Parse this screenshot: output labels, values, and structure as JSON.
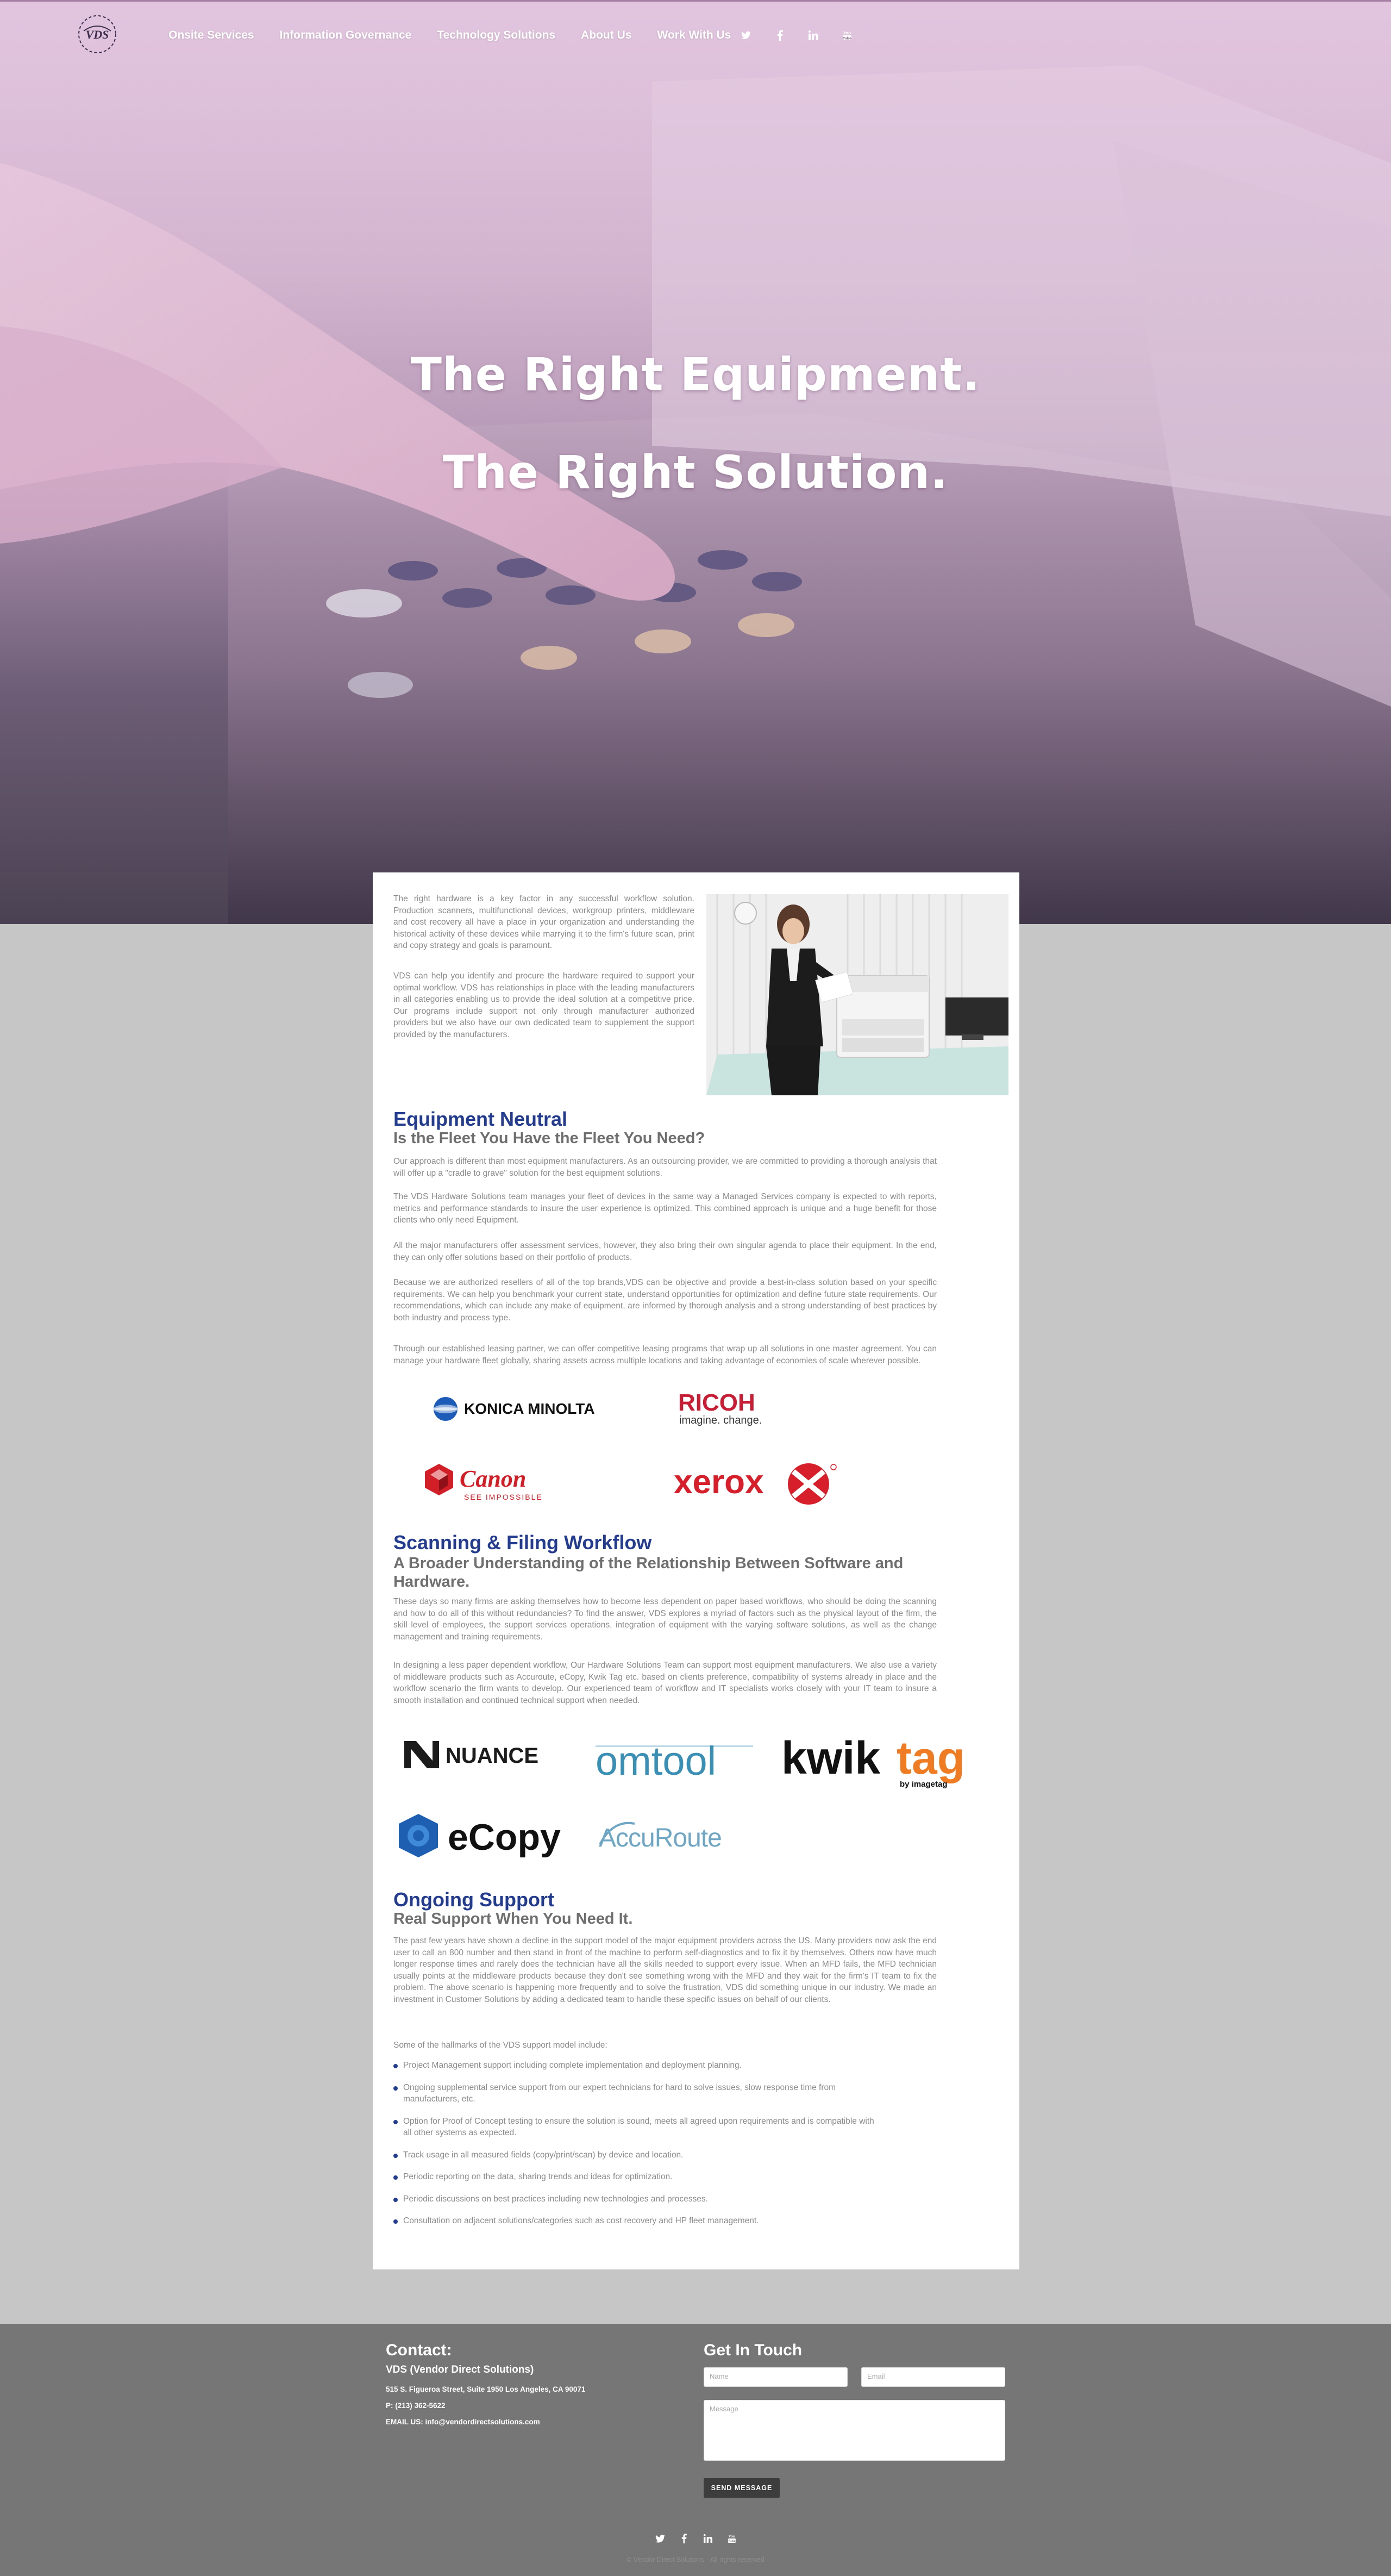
{
  "nav": {
    "logo_text": "VDS",
    "links": [
      "Onsite Services",
      "Information Governance",
      "Technology Solutions",
      "About Us",
      "Work With Us"
    ],
    "social": [
      "twitter-icon",
      "facebook-icon",
      "linkedin-icon",
      "youtube-icon"
    ]
  },
  "hero": {
    "line1": "The Right Equipment.",
    "line2": "The Right Solution."
  },
  "intro": {
    "p1": "The right hardware is a key factor in any successful workflow solution. Production scanners, multifunctional devices, workgroup printers, middleware and cost recovery all have a place in your organization and understanding the historical activity of these devices while marrying it to the firm's future scan, print and copy strategy and goals is paramount.",
    "p2": "VDS can help you identify and procure the hardware required to support your optimal workflow. VDS has relationships in place with the leading manufacturers in all categories enabling us to provide the ideal solution at a competitive price. Our programs include support not only through manufacturer authorized providers but we also have our own dedicated team to supplement the support provided by the manufacturers."
  },
  "equipment": {
    "title": "Equipment Neutral",
    "subtitle": "Is the Fleet You Have the Fleet You Need?",
    "p1": "Our approach is different than most equipment manufacturers. As an outsourcing provider, we are committed to providing a thorough analysis that will offer up a \"cradle to grave\" solution for the best equipment solutions.",
    "p2": "The VDS Hardware Solutions team manages your fleet of devices in the same way a Managed Services company is expected to with reports, metrics and performance standards to insure the user experience is optimized. This combined approach is unique and a huge benefit for those clients who only need Equipment.",
    "p3": "All the major manufacturers offer assessment services, however, they also bring their own singular agenda to place their equipment. In the end, they can only offer solutions based on their portfolio of products.",
    "p4": "Because we are authorized resellers of all of the top brands,VDS can be objective and provide a best-in-class solution based on your specific requirements. We can help you benchmark your current state, understand opportunities for optimization and define future state requirements. Our recommendations, which can include any make of equipment, are informed by thorough analysis and a strong understanding of best practices by both industry and process type.",
    "p5": "Through our established leasing partner, we can offer competitive leasing programs that wrap up all solutions in one master agreement. You can manage your hardware fleet globally, sharing assets across multiple locations and taking advantage of economies of scale wherever possible.",
    "logos": {
      "konica": "KONICA MINOLTA",
      "ricoh": "RICOH",
      "ricoh_tag": "imagine. change.",
      "canon": "Canon",
      "canon_tag": "SEE IMPOSSIBLE",
      "xerox": "xerox"
    }
  },
  "scanning": {
    "title": "Scanning & Filing Workflow",
    "subtitle": "A Broader Understanding of the Relationship Between Software and Hardware.",
    "p1": "These days so many firms are asking themselves how to become less dependent on paper based workflows, who should be doing the scanning and how to do all of this without redundancies? To find the answer, VDS explores a myriad of factors such as the physical layout of the firm, the skill level of employees, the support services operations, integration of equipment with the varying software solutions, as well as the change management and training requirements.",
    "p2": "In designing a less paper dependent workflow, Our Hardware Solutions Team can support most equipment manufacturers. We also use a variety of middleware products such as Accuroute, eCopy, Kwik Tag etc. based on clients preference, compatibility of systems already in place and the workflow scenario the firm wants to develop. Our experienced team of workflow and IT specialists works closely with your IT team to insure a smooth installation and continued technical support when needed.",
    "logos": {
      "nuance": "NUANCE",
      "omtool": "omtool",
      "kwik": "kwik",
      "tag": "tag",
      "kwik_by": "by imagetag",
      "ecopy": "eCopy",
      "accuroute": "AccuRoute"
    }
  },
  "support": {
    "title": "Ongoing Support",
    "subtitle": "Real Support When You Need It.",
    "p1": "The past few years have shown a decline in the support model of the major equipment providers across the US. Many providers now ask the end user to call an 800 number and then stand in front of the machine to perform self-diagnostics and to fix it by themselves. Others now have much longer response times and rarely does the technician have all the skills needed to support every issue. When an MFD fails, the MFD technician usually points at the middleware products because they don't see something wrong with the MFD and they wait for the firm's IT team to fix the problem. The above scenario is happening more frequently and to solve the frustration, VDS did something unique in our industry. We made an investment in Customer Solutions by adding a dedicated team to handle these specific issues on behalf of our clients.",
    "intro": "Some of the hallmarks of the VDS support model include:",
    "bullets": [
      "Project Management support including complete implementation and deployment planning.",
      "Ongoing supplemental service support from our expert technicians for hard to solve issues, slow response time from manufacturers, etc.",
      "Option for Proof of Concept testing to ensure the solution is sound, meets all agreed upon requirements and is compatible with all other systems as expected.",
      "Track usage in all measured fields (copy/print/scan) by device and location.",
      "Periodic reporting on the data, sharing trends and ideas for optimization.",
      "Periodic discussions on best practices including new technologies and processes.",
      "Consultation on adjacent solutions/categories such as cost recovery and HP fleet management."
    ]
  },
  "footer": {
    "contact_heading": "Contact:",
    "company": "VDS (Vendor Direct Solutions)",
    "address": "515 S. Figueroa Street, Suite 1950 Los Angeles, CA 90071",
    "phone": "P: (213) 362-5622",
    "email": "EMAIL US: info@vendordirectsolutions.com",
    "touch_heading": "Get In Touch",
    "name_placeholder": "Name",
    "email_placeholder": "Email",
    "message_placeholder": "Message",
    "send_label": "SEND MESSAGE",
    "copyright": "© Vendor Direct Solutions - All rights reserved"
  },
  "colors": {
    "heading_blue": "#233c8f",
    "footer_bg": "#767676",
    "page_bg": "#c6c6c6"
  }
}
